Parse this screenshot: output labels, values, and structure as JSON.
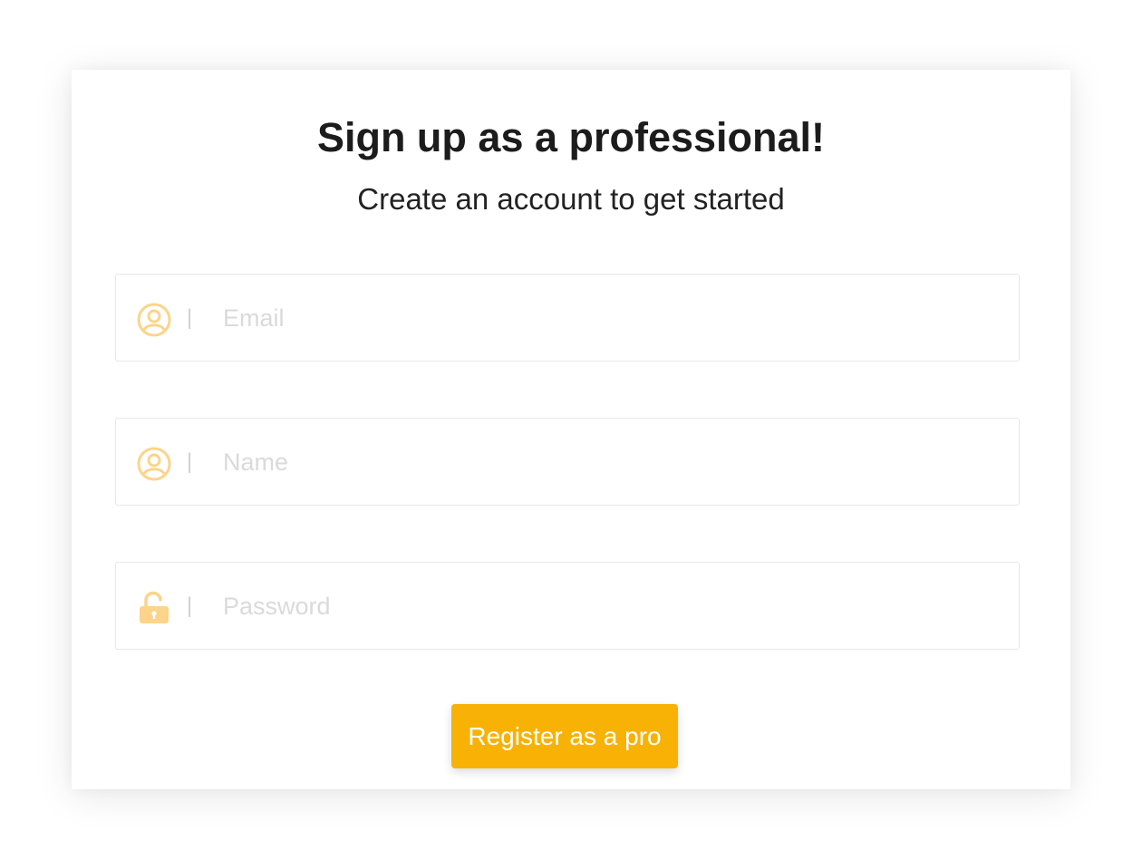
{
  "header": {
    "title": "Sign up as a professional!",
    "subtitle": "Create an account to get started"
  },
  "form": {
    "separator": "|",
    "email": {
      "placeholder": "Email",
      "value": "",
      "icon": "user-circle-icon"
    },
    "name": {
      "placeholder": "Name",
      "value": "",
      "icon": "user-circle-icon"
    },
    "password": {
      "placeholder": "Password",
      "value": "",
      "icon": "unlock-icon"
    },
    "submit_label": "Register as a pro"
  },
  "colors": {
    "accent": "#f7b205",
    "icon": "#fcd48a",
    "title": "#1c1c1c",
    "placeholder": "#dadada",
    "border": "#e8e8e8"
  }
}
